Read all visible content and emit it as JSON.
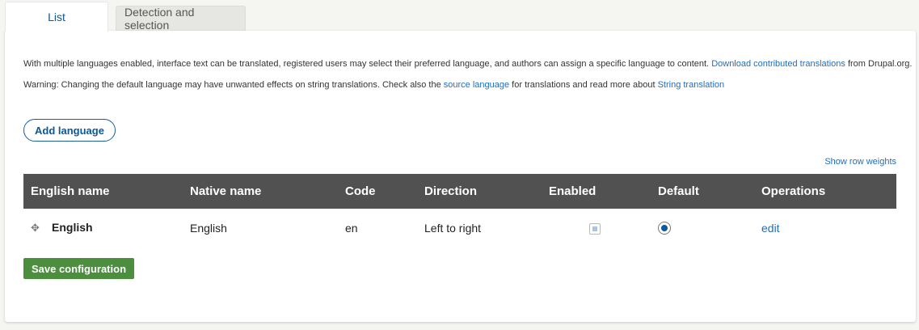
{
  "tabs": [
    {
      "label": "List",
      "active": true
    },
    {
      "label": "Detection and selection",
      "active": false
    }
  ],
  "description": {
    "text": "With multiple languages enabled, interface text can be translated, registered users may select their preferred language, and authors can assign a specific language to content. ",
    "link": "Download contributed translations",
    "suffix": " from Drupal.org."
  },
  "warning": {
    "label": "Warning",
    "text": ": Changing the default language may have unwanted effects on string translations. Check also the ",
    "link1": "source language",
    "middle": " for translations and read more about ",
    "link2": "String translation"
  },
  "add_language_label": "Add language",
  "show_row_weights_label": "Show row weights",
  "table": {
    "headers": [
      "English name",
      "Native name",
      "Code",
      "Direction",
      "Enabled",
      "Default",
      "Operations"
    ],
    "rows": [
      {
        "english_name": "English",
        "native_name": "English",
        "code": "en",
        "direction": "Left to right",
        "enabled": true,
        "default": true,
        "operation": "edit"
      }
    ]
  },
  "save_label": "Save configuration",
  "colors": {
    "link": "#1f6ebe",
    "header_bg": "#515151",
    "save_bg": "#4b8e3d"
  }
}
